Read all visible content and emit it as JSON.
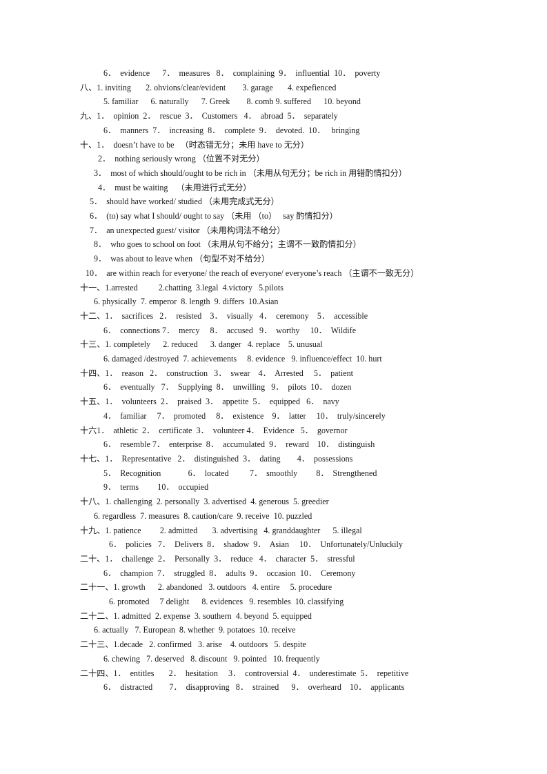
{
  "document": {
    "type": "answer-key",
    "language": "English exercises with Chinese grading notes",
    "lines": [
      {
        "indent": "i4",
        "text": "6．  evidence      7．  measures   8．  complaining  9．  influential  10．  poverty"
      },
      {
        "indent": "i0",
        "text": "八、1. inviting       2. ohvions/clear/evident        3. garage       4. expefienced"
      },
      {
        "indent": "i4",
        "text": "5. familiar      6. naturally      7. Greek        8. comb 9. suffered      10. beyond"
      },
      {
        "indent": "i0",
        "text": "九、1．  opinion  2．  rescue  3．  Customers   4．  abroad  5．  separately"
      },
      {
        "indent": "i4",
        "text": "6．  manners  7．  increasing  8．  complete  9．  devoted.  10．   bringing"
      },
      {
        "indent": "i0",
        "text": "十、1．  doesn’t have to be   （时态错无分；未用 have to 无分）"
      },
      {
        "indent": "i3",
        "text": "2．  nothing seriously wrong （位置不对无分）"
      },
      {
        "indent": "i2",
        "text": "3．  most of which should/ought to be rich in （未用从句无分；be rich in 用错酌情扣分）"
      },
      {
        "indent": "i3",
        "text": "4．  must be waiting    （未用进行式无分）"
      },
      {
        "indent": "i1",
        "text": "5．  should have worked/ studied （未用完成式无分）"
      },
      {
        "indent": "i1",
        "text": "6．  (to) say what I should/ ought to say （未用 （to）   say 酌情扣分）"
      },
      {
        "indent": "i1",
        "text": "7．  an unexpected guest/ visitor （未用构词法不给分）"
      },
      {
        "indent": "i2",
        "text": "8．  who goes to school on foot （未用从句不给分；主谓不一致酌情扣分）"
      },
      {
        "indent": "i2",
        "text": "9．  was about to leave when （句型不对不给分）"
      },
      {
        "indent": "i6",
        "text": "10．  are within reach for everyone/ the reach of everyone/ everyone’s reach （主谓不一致无分）"
      },
      {
        "indent": "i0",
        "text": "十一、1.arrested          2.chatting  3.legal  4.victory   5.pilots"
      },
      {
        "indent": "i2",
        "text": "6. physically  7. emperor  8. length  9. differs  10.Asian"
      },
      {
        "indent": "i0",
        "text": "十二、1．  sacrifices   2．  resisted    3．  visually   4．  ceremony    5．  accessible"
      },
      {
        "indent": "i4",
        "text": "6．  connections 7．  mercy     8．  accused   9．  worthy     10．  Wildife"
      },
      {
        "indent": "i0",
        "text": "十三、1. completely      2. reduced      3. danger   4. replace    5. unusual"
      },
      {
        "indent": "i4",
        "text": "6. damaged /destroyed  7. achievements     8. evidence   9. influence/effect  10. hurt"
      },
      {
        "indent": "i0",
        "text": "十四、1．  reason   2．  construction   3．  swear    4．  Arrested     5．  patient"
      },
      {
        "indent": "i4",
        "text": "6．  eventually   7．  Supplying  8．  unwilling   9．  pilots  10．  dozen"
      },
      {
        "indent": "i0",
        "text": "十五、1．  volunteers  2．  praised  3．  appetite  5．  equipped   6．  navy"
      },
      {
        "indent": "i4",
        "text": "4．  familiar     7．  promoted     8．  existence    9．  latter     10．  truly/sincerely"
      },
      {
        "indent": "i0",
        "text": "十六1．  athletic  2．  certificate  3．  volunteer 4．  Evidence   5．  governor"
      },
      {
        "indent": "i4",
        "text": "6．  resemble 7．  enterprise  8．  accumulated  9．  reward    10．  distinguish"
      },
      {
        "indent": "i0",
        "text": "十七、1．  Representative   2．  distinguished  3．  dating        4．  possessions"
      },
      {
        "indent": "i4",
        "text": "5．  Recognition             6．  located          7．  smoothly         8．  Strengthened"
      },
      {
        "indent": "i4",
        "text": "9．  terms         10．  occupied"
      },
      {
        "indent": "i0",
        "text": "十八、1. challenging  2. personally  3. advertised  4. generous  5. greedier"
      },
      {
        "indent": "i2",
        "text": "6. regardless  7. measures  8. caution/care  9. receive  10. puzzled"
      },
      {
        "indent": "i0",
        "text": "十九、1. patience         2. admitted       3. advertising   4. granddaughter      5. illegal"
      },
      {
        "indent": "i5",
        "text": "6．  policies   7．  Delivers  8．  shadow  9．  Asian     10．  Unfortunately/Unluckily"
      },
      {
        "indent": "i0",
        "text": "二十、1．  challenge  2．  Personally  3．  reduce   4．  character  5．  stressful"
      },
      {
        "indent": "i4",
        "text": "6．  champion  7．  struggled  8．  adults  9．  occasion  10．  Ceremony"
      },
      {
        "indent": "i0",
        "text": "二十一、1. growth      2. abandoned   3. outdoors   4. entire     5. procedure"
      },
      {
        "indent": "i5",
        "text": "6. promoted     7 delight      8. evidences   9. resembles  10. classifying"
      },
      {
        "indent": "i0",
        "text": "二十二、1. admitted  2. expense  3. southern  4. beyond  5. equipped"
      },
      {
        "indent": "i2",
        "text": "6. actually   7. European  8. whether  9. potatoes  10. receive"
      },
      {
        "indent": "i0",
        "text": "二十三、1.decade   2. confirmed   3. arise    4. outdoors   5. despite"
      },
      {
        "indent": "i4",
        "text": "6. chewing   7. deserved   8. discount   9. pointed   10. frequently"
      },
      {
        "indent": "i0",
        "text": "二十四、1．  entitles       2．  hesitation     3．  controversial  4．  underestimate  5．  repetitive"
      },
      {
        "indent": "i4",
        "text": "6．  distracted        7．  disapproving   8．  strained      9．  overheard    10．  applicants"
      }
    ]
  }
}
